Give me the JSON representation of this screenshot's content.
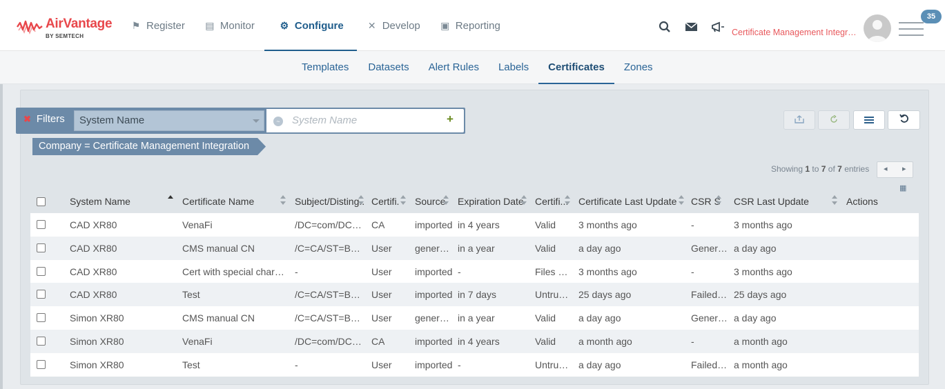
{
  "logo": {
    "brand": "AirVantage",
    "sub": "BY SEMTECH"
  },
  "nav": [
    {
      "label": "Register",
      "icon": "flag-icon",
      "glyph": "⚑",
      "active": false
    },
    {
      "label": "Monitor",
      "icon": "monitor-icon",
      "glyph": "▤",
      "active": false
    },
    {
      "label": "Configure",
      "icon": "gear-icon",
      "glyph": "⚙",
      "active": true
    },
    {
      "label": "Develop",
      "icon": "tools-icon",
      "glyph": "✕",
      "active": false
    },
    {
      "label": "Reporting",
      "icon": "report-icon",
      "glyph": "▣",
      "active": false
    }
  ],
  "header": {
    "company": "Certificate Management Integration",
    "notifications": "35"
  },
  "subnav": [
    {
      "label": "Templates",
      "active": false
    },
    {
      "label": "Datasets",
      "active": false
    },
    {
      "label": "Alert Rules",
      "active": false
    },
    {
      "label": "Labels",
      "active": false
    },
    {
      "label": "Certificates",
      "active": true
    },
    {
      "label": "Zones",
      "active": false
    }
  ],
  "filter": {
    "label": "Filters",
    "field": "System Name",
    "placeholder": "System Name",
    "chip": "Company = Certificate Management Integration"
  },
  "entries": {
    "prefix": "Showing",
    "from": "1",
    "to_word": "to",
    "to": "7",
    "of_word": "of",
    "total": "7",
    "suffix": "entries"
  },
  "columns": [
    "System Name",
    "Certificate Name",
    "Subject/Disting...",
    "Certifi...",
    "Source",
    "Expiration Date",
    "Certifi...",
    "Certificate Last Update",
    "CSR St...",
    "CSR Last Update",
    "Actions"
  ],
  "rows": [
    [
      "CAD XR80",
      "VenaFi",
      "/DC=com/DC=ve...",
      "CA",
      "imported",
      "in 4 years",
      "Valid",
      "3 months ago",
      "-",
      "3 months ago"
    ],
    [
      "CAD XR80",
      "CMS manual CN",
      "/C=CA/ST=BC/L...",
      "User",
      "generat...",
      "in a year",
      "Valid",
      "a day ago",
      "Genera...",
      "a day ago"
    ],
    [
      "CAD XR80",
      "Cert with special characte...",
      "-",
      "User",
      "imported",
      "-",
      "Files mi...",
      "3 months ago",
      "-",
      "3 months ago"
    ],
    [
      "CAD XR80",
      "Test",
      "/C=CA/ST=BC/L...",
      "User",
      "imported",
      "in 7 days",
      "Untrust...",
      "25 days ago",
      "Failed t...",
      "25 days ago"
    ],
    [
      "Simon XR80",
      "CMS manual CN",
      "/C=CA/ST=BC/L...",
      "User",
      "generat...",
      "in a year",
      "Valid",
      "a day ago",
      "Genera...",
      "a day ago"
    ],
    [
      "Simon XR80",
      "VenaFi",
      "/DC=com/DC=ve...",
      "CA",
      "imported",
      "in 4 years",
      "Valid",
      "a month ago",
      "-",
      "a month ago"
    ],
    [
      "Simon XR80",
      "Test",
      "-",
      "User",
      "imported",
      "-",
      "Untrust...",
      "a day ago",
      "Failed t...",
      "a month ago"
    ]
  ]
}
